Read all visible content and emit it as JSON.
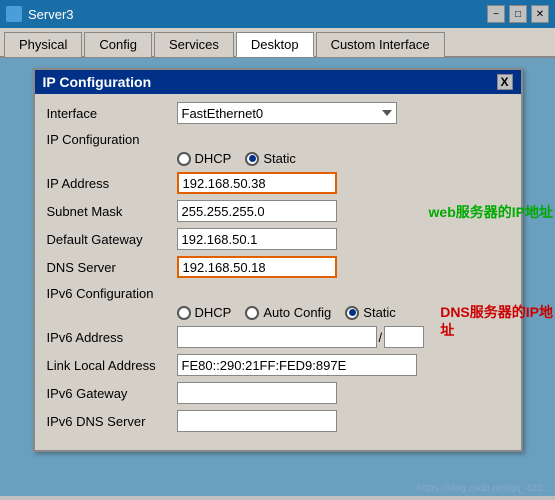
{
  "window": {
    "title": "Server3",
    "icon": "server-icon"
  },
  "title_controls": {
    "minimize": "−",
    "maximize": "□",
    "close": "✕"
  },
  "tabs": [
    {
      "label": "Physical",
      "active": false
    },
    {
      "label": "Config",
      "active": false
    },
    {
      "label": "Services",
      "active": false
    },
    {
      "label": "Desktop",
      "active": true
    },
    {
      "label": "Custom Interface",
      "active": false
    }
  ],
  "dialog": {
    "title": "IP Configuration",
    "close_label": "X",
    "interface_label": "Interface",
    "interface_value": "FastEthernet0",
    "ip_config_section": "IP Configuration",
    "dhcp_label": "DHCP",
    "static_label": "Static",
    "static_selected": true,
    "dhcp_selected": false,
    "ip_address_label": "IP Address",
    "ip_address_value": "192.168.50.38",
    "subnet_mask_label": "Subnet Mask",
    "subnet_mask_value": "255.255.255.0",
    "default_gateway_label": "Default Gateway",
    "default_gateway_value": "192.168.50.1",
    "dns_server_label": "DNS Server",
    "dns_server_value": "192.168.50.18",
    "ipv6_section": "IPv6 Configuration",
    "ipv6_dhcp_label": "DHCP",
    "ipv6_auto_label": "Auto Config",
    "ipv6_static_label": "Static",
    "ipv6_static_selected": true,
    "ipv6_address_label": "IPv6 Address",
    "ipv6_address_value": "",
    "ipv6_prefix_value": "",
    "link_local_label": "Link Local Address",
    "link_local_value": "FE80::290:21FF:FED9:897E",
    "ipv6_gateway_label": "IPv6 Gateway",
    "ipv6_gateway_value": "",
    "ipv6_dns_label": "IPv6 DNS Server",
    "ipv6_dns_value": ""
  },
  "annotations": {
    "web_annotation": "web服务器的IP地址",
    "dns_annotation": "DNS服务器的IP地\n址"
  },
  "watermark": "https://blog.csdn.net/qq_432..."
}
